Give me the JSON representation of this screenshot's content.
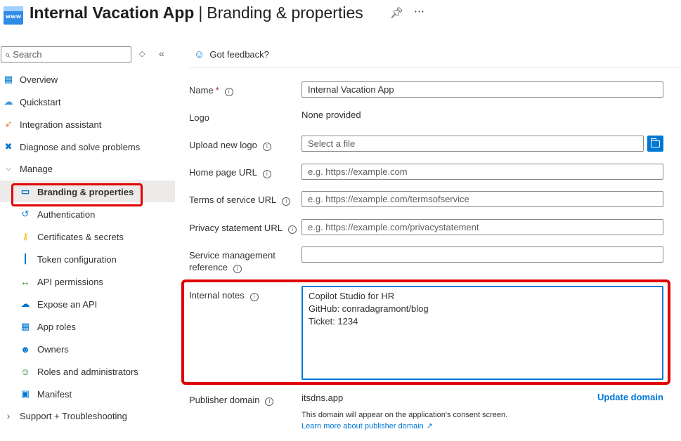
{
  "header": {
    "app_name": "Internal Vacation App",
    "separator": "|",
    "page": "Branding & properties",
    "app_icon_text": "www",
    "pin_icon": "pin-icon",
    "more_icon": "more-icon"
  },
  "sidebar": {
    "search_placeholder": "Search",
    "items": [
      {
        "label": "Overview",
        "icon": "overview-icon"
      },
      {
        "label": "Quickstart",
        "icon": "quickstart-cloud-icon"
      },
      {
        "label": "Integration assistant",
        "icon": "rocket-icon"
      },
      {
        "label": "Diagnose and solve problems",
        "icon": "wrench-icon"
      },
      {
        "label": "Manage",
        "icon": "chevron-down-icon"
      },
      {
        "label": "Branding & properties",
        "icon": "branding-icon",
        "active": true
      },
      {
        "label": "Authentication",
        "icon": "authentication-icon"
      },
      {
        "label": "Certificates & secrets",
        "icon": "key-icon"
      },
      {
        "label": "Token configuration",
        "icon": "token-icon"
      },
      {
        "label": "API permissions",
        "icon": "api-permissions-icon"
      },
      {
        "label": "Expose an API",
        "icon": "cloud-api-icon"
      },
      {
        "label": "App roles",
        "icon": "app-roles-icon"
      },
      {
        "label": "Owners",
        "icon": "owners-icon"
      },
      {
        "label": "Roles and administrators",
        "icon": "roles-admin-icon"
      },
      {
        "label": "Manifest",
        "icon": "manifest-icon"
      },
      {
        "label": "Support + Troubleshooting",
        "icon": "chevron-right-icon"
      }
    ]
  },
  "main": {
    "feedback": "Got feedback?",
    "fields": {
      "name": {
        "label": "Name",
        "required_mark": "*",
        "value": "Internal Vacation App"
      },
      "logo": {
        "label": "Logo",
        "value": "None provided"
      },
      "upload_logo": {
        "label": "Upload new logo",
        "placeholder": "Select a file"
      },
      "home_page": {
        "label": "Home page URL",
        "placeholder": "e.g. https://example.com"
      },
      "terms": {
        "label": "Terms of service URL",
        "placeholder": "e.g. https://example.com/termsofservice"
      },
      "privacy": {
        "label": "Privacy statement URL",
        "placeholder": "e.g. https://example.com/privacystatement"
      },
      "service_mgmt": {
        "label_line1": "Service management",
        "label_line2": "reference",
        "value": ""
      },
      "internal_notes": {
        "label": "Internal notes",
        "lines": [
          "Copilot Studio for HR",
          "GitHub: conradagramont/blog",
          "Ticket: 1234"
        ]
      },
      "publisher_domain": {
        "label": "Publisher domain",
        "value": "itsdns.app",
        "update_label": "Update domain",
        "note": "This domain will appear on the application's consent screen.",
        "learn_more": "Learn more about publisher domain"
      }
    }
  },
  "colors": {
    "accent": "#0078d4",
    "highlight": "#e00000",
    "required": "#a4262c"
  }
}
